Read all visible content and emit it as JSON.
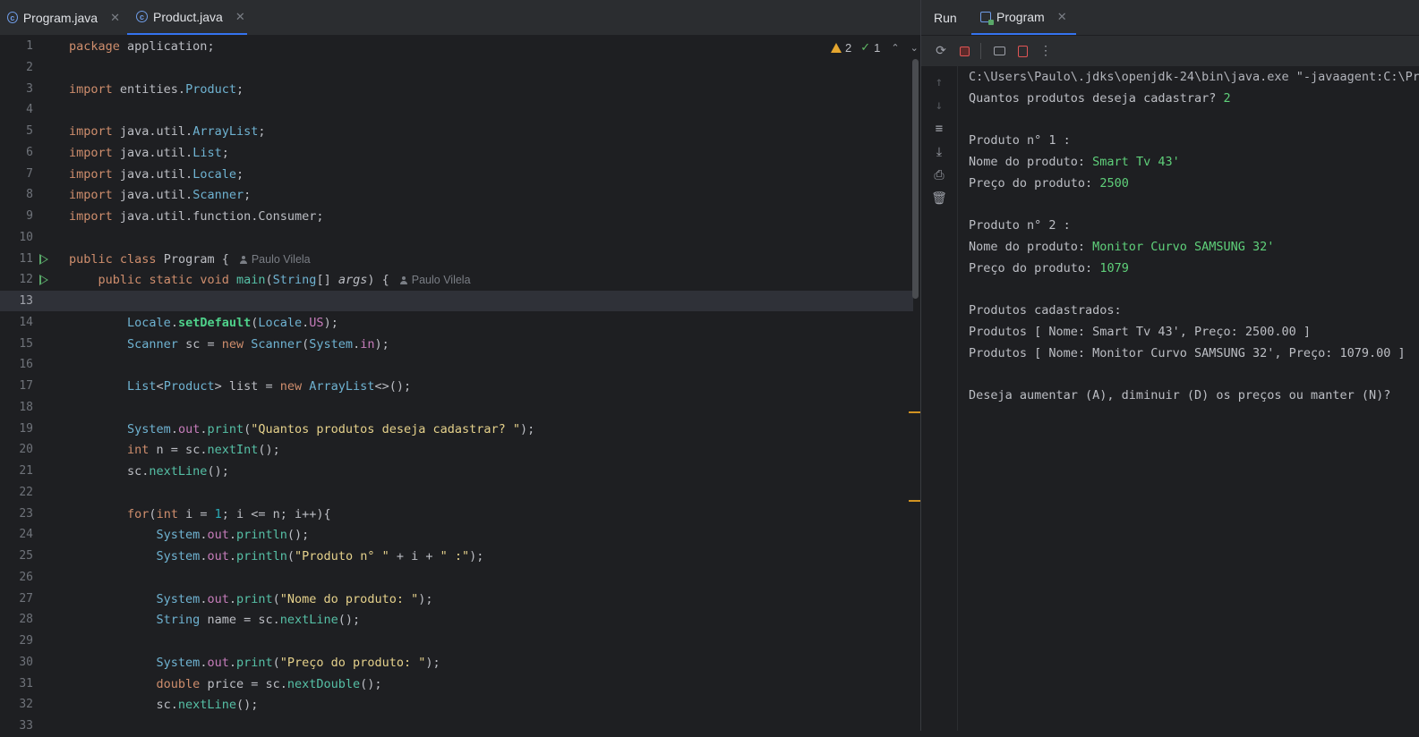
{
  "editor": {
    "tabs": [
      {
        "label": "Program.java",
        "icon": "java-class-icon",
        "active": false
      },
      {
        "label": "Product.java",
        "icon": "java-class-icon",
        "active": true
      }
    ],
    "inspections": {
      "warnings": "2",
      "weak_warnings": "1"
    },
    "author_hint": "Paulo Vilela",
    "line_numbers": [
      "1",
      "2",
      "3",
      "4",
      "5",
      "6",
      "7",
      "8",
      "9",
      "10",
      "11",
      "12",
      "13",
      "14",
      "15",
      "16",
      "17",
      "18",
      "19",
      "20",
      "21",
      "22",
      "23",
      "24",
      "25",
      "26",
      "27",
      "28",
      "29",
      "30",
      "31",
      "32",
      "33"
    ],
    "current_line": "13",
    "code_lines": [
      "package application;",
      "",
      "import entities.Product;",
      "",
      "import java.util.ArrayList;",
      "import java.util.List;",
      "import java.util.Locale;",
      "import java.util.Scanner;",
      "import java.util.function.Consumer;",
      "",
      "public class Program {",
      "    public static void main(String[] args) {",
      "",
      "        Locale.setDefault(Locale.US);",
      "        Scanner sc = new Scanner(System.in);",
      "",
      "        List<Product> list = new ArrayList<>();",
      "",
      "        System.out.print(\"Quantos produtos deseja cadastrar? \");",
      "        int n = sc.nextInt();",
      "        sc.nextLine();",
      "",
      "        for(int i = 1; i <= n; i++){",
      "            System.out.println();",
      "            System.out.println(\"Produto n° \" + i + \" :\");",
      "",
      "            System.out.print(\"Nome do produto: \");",
      "            String name = sc.nextLine();",
      "",
      "            System.out.print(\"Preço do produto: \");",
      "            double price = sc.nextDouble();",
      "            sc.nextLine();"
    ]
  },
  "run": {
    "tabs": [
      {
        "label": "Run",
        "active": false
      },
      {
        "label": "Program",
        "active": true
      }
    ],
    "console_lines": [
      {
        "text": "C:\\Users\\Paulo\\.jdks\\openjdk-24\\bin\\java.exe \"-javaagent:C:\\Pr",
        "input": ""
      },
      {
        "text": "Quantos produtos deseja cadastrar? ",
        "input": "2"
      },
      {
        "text": "",
        "input": ""
      },
      {
        "text": "Produto n° 1 :",
        "input": ""
      },
      {
        "text": "Nome do produto: ",
        "input": "Smart Tv 43'"
      },
      {
        "text": "Preço do produto: ",
        "input": "2500"
      },
      {
        "text": "",
        "input": ""
      },
      {
        "text": "Produto n° 2 :",
        "input": ""
      },
      {
        "text": "Nome do produto: ",
        "input": "Monitor Curvo SAMSUNG 32'"
      },
      {
        "text": "Preço do produto: ",
        "input": "1079"
      },
      {
        "text": "",
        "input": ""
      },
      {
        "text": "Produtos cadastrados:",
        "input": ""
      },
      {
        "text": "Produtos [ Nome: Smart Tv 43', Preço: 2500.00 ]",
        "input": ""
      },
      {
        "text": "Produtos [ Nome: Monitor Curvo SAMSUNG 32', Preço: 1079.00 ]",
        "input": ""
      },
      {
        "text": "",
        "input": ""
      },
      {
        "text": "Deseja aumentar (A), diminuir (D) os preços ou manter (N)?",
        "input": ""
      }
    ]
  },
  "colors": {
    "background": "#1e1f22",
    "panel": "#2b2d30",
    "accent": "#3574f0",
    "keyword": "#cf8e6d",
    "string": "#e5d18b",
    "console_input": "#5fd07a",
    "run_marker": "#59a869",
    "warning": "#e4a62f"
  }
}
